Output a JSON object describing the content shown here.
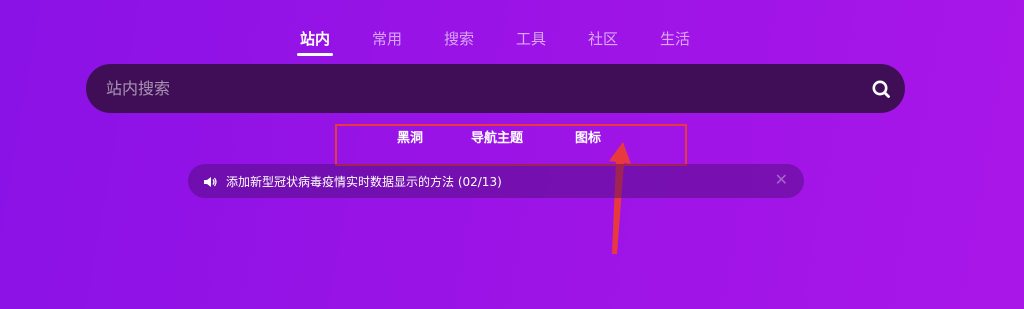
{
  "tabs": [
    {
      "label": "站内",
      "active": true
    },
    {
      "label": "常用",
      "active": false
    },
    {
      "label": "搜索",
      "active": false
    },
    {
      "label": "工具",
      "active": false
    },
    {
      "label": "社区",
      "active": false
    },
    {
      "label": "生活",
      "active": false
    }
  ],
  "search": {
    "placeholder": "站内搜索",
    "value": "",
    "icon": "search-icon"
  },
  "sublinks": [
    {
      "label": "黑洞"
    },
    {
      "label": "导航主题"
    },
    {
      "label": "图标"
    }
  ],
  "notice": {
    "icon": "speaker-icon",
    "text": "添加新型冠状病毒疫情实时数据显示的方法 (02/13)",
    "close_icon": "close-icon"
  },
  "colors": {
    "background_start": "#8a12e6",
    "background_end": "#a916e8",
    "search_bg": "#3f0e57",
    "annotation": "#e8393f"
  }
}
